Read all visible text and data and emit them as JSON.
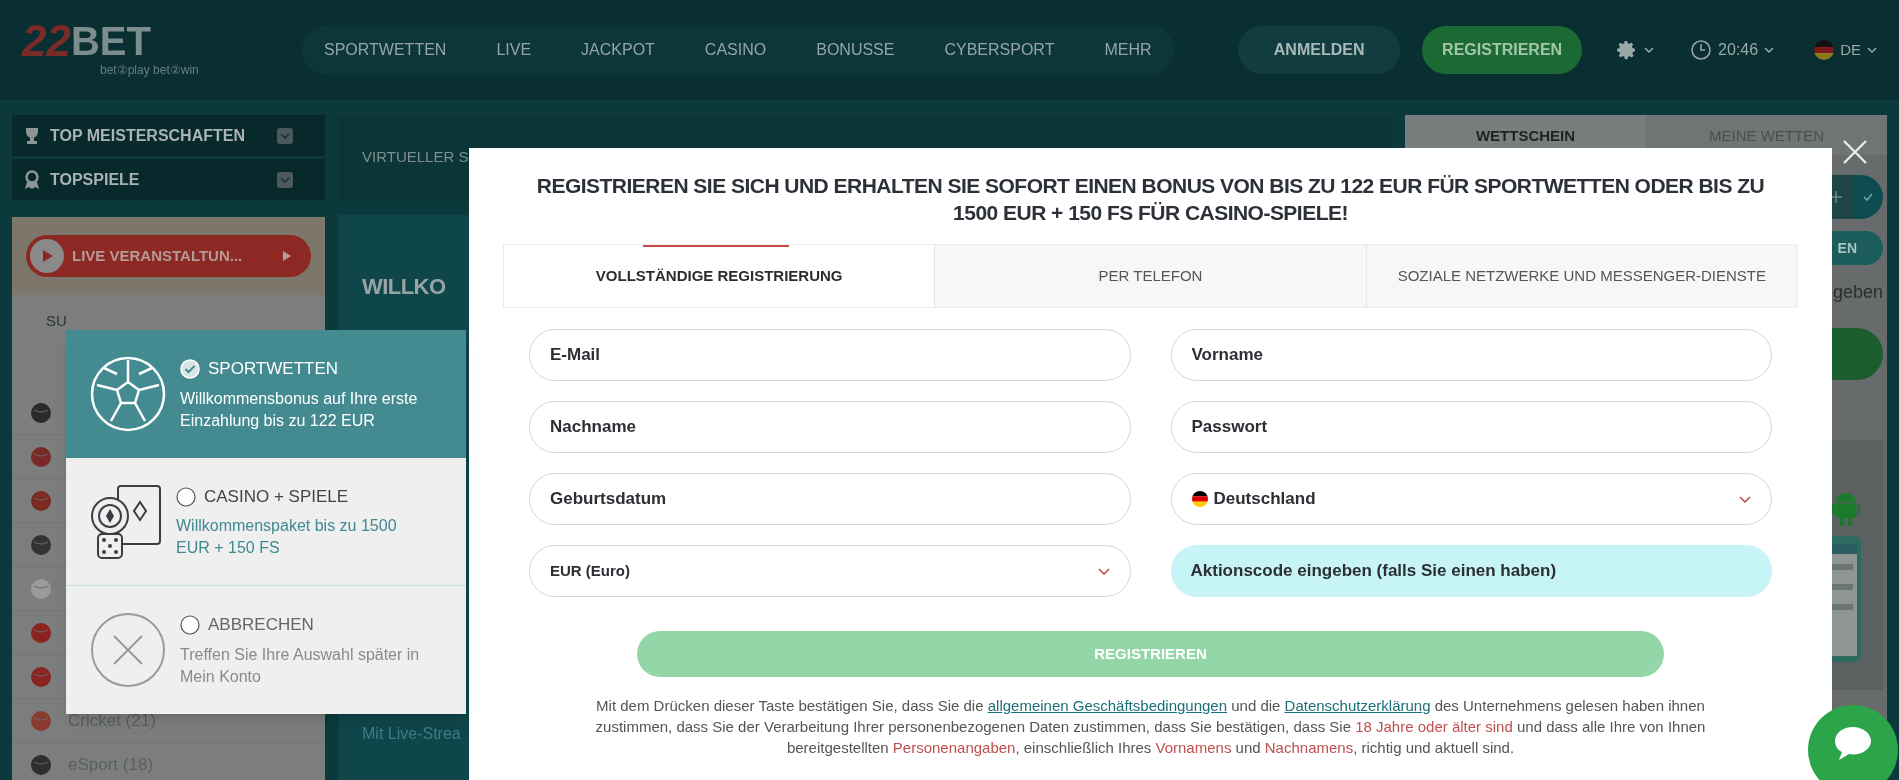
{
  "header": {
    "logo": {
      "mark": "22",
      "name": "BET",
      "slogan": "bet②play bet②win"
    },
    "nav": [
      "SPORTWETTEN",
      "LIVE",
      "JACKPOT",
      "CASINO",
      "BONUSSE",
      "CYBERSPORT",
      "MEHR"
    ],
    "login_button": "ANMELDEN",
    "register_button": "REGISTRIEREN",
    "time": "20:46",
    "language": "DE"
  },
  "sidebar": {
    "menus": [
      {
        "kind": "trophy",
        "label": "TOP MEISTERSCHAFTEN"
      },
      {
        "kind": "medal",
        "label": "TOPSPIELE"
      }
    ],
    "live_button": "LIVE VERANSTALTUN...",
    "search_text": "SU",
    "sports": [
      {
        "kind": "soccer"
      },
      {
        "kind": "tennis"
      },
      {
        "kind": "basketball"
      },
      {
        "kind": "hockey"
      },
      {
        "kind": "volleyball"
      },
      {
        "kind": "tabletennis"
      },
      {
        "kind": "handball"
      },
      {
        "kind": "cricket",
        "label": "Cricket (21)"
      },
      {
        "kind": "esport",
        "label": "eSport (18)"
      }
    ]
  },
  "content": {
    "tab_text": "VIRTUELLER S",
    "banner_title": "WILLKO",
    "banner_link": "Mit Live-Strea"
  },
  "betslip": {
    "tabs": [
      {
        "label": "WETTSCHEIN",
        "selected": true
      },
      {
        "label": "MEINE WETTEN",
        "selected": false
      }
    ],
    "button_text": "EN",
    "text": "geben"
  },
  "bonus_popup": {
    "options": [
      {
        "kind": "sport",
        "title": "SPORTWETTEN",
        "description": "Willkommensbonus auf Ihre erste Einzahlung bis zu 122 EUR",
        "selected": true
      },
      {
        "kind": "casino",
        "title": "CASINO + SPIELE",
        "description": "Willkommenspaket bis zu 1500 EUR + 150 FS",
        "selected": false
      },
      {
        "kind": "cancel",
        "title": "ABBRECHEN",
        "description": "Treffen Sie Ihre Auswahl später in Mein Konto",
        "selected": false
      }
    ]
  },
  "modal": {
    "title": "REGISTRIEREN SIE SICH UND ERHALTEN SIE SOFORT EINEN BONUS VON BIS ZU 122 EUR FÜR SPORTWETTEN ODER BIS ZU 1500 EUR + 150 FS FÜR CASINO-SPIELE!",
    "tabs": [
      {
        "label": "VOLLSTÄNDIGE REGISTRIERUNG",
        "selected": true
      },
      {
        "label": "PER TELEFON",
        "selected": false
      },
      {
        "label": "SOZIALE NETZWERKE UND MESSENGER-DIENSTE",
        "selected": false
      }
    ],
    "fields": [
      {
        "kind": "text",
        "placeholder": "E-Mail"
      },
      {
        "kind": "text",
        "placeholder": "Vorname"
      },
      {
        "kind": "text",
        "placeholder": "Nachname"
      },
      {
        "kind": "text",
        "placeholder": "Passwort"
      },
      {
        "kind": "text",
        "placeholder": "Geburtsdatum"
      },
      {
        "kind": "country",
        "value": "Deutschland"
      },
      {
        "kind": "select",
        "value": "EUR (Euro)"
      },
      {
        "kind": "promo",
        "placeholder": "Aktionscode eingeben (falls Sie einen haben)"
      }
    ],
    "submit": "REGISTRIEREN",
    "legal": [
      {
        "kind": "plain",
        "text": "Mit dem Drücken dieser Taste bestätigen Sie, dass Sie die "
      },
      {
        "kind": "link",
        "text": "allgemeinen Geschäftsbedingungen"
      },
      {
        "kind": "plain",
        "text": " und die "
      },
      {
        "kind": "link",
        "text": "Datenschutzerklärung"
      },
      {
        "kind": "plain",
        "text": " des Unternehmens gelesen haben ihnen zustimmen, dass Sie der Verarbeitung Ihrer personenbezogenen Daten zustimmen, dass Sie bestätigen, dass Sie "
      },
      {
        "kind": "highlight",
        "text": "18 Jahre oder älter sind"
      },
      {
        "kind": "plain",
        "text": " und dass alle Ihre von Ihnen bereitgestellten "
      },
      {
        "kind": "highlight",
        "text": "Personenangaben"
      },
      {
        "kind": "plain",
        "text": ", einschließlich Ihres "
      },
      {
        "kind": "highlight",
        "text": "Vornamens"
      },
      {
        "kind": "plain",
        "text": " und "
      },
      {
        "kind": "highlight",
        "text": "Nachnamens"
      },
      {
        "kind": "plain",
        "text": ", richtig und aktuell sind."
      }
    ]
  }
}
